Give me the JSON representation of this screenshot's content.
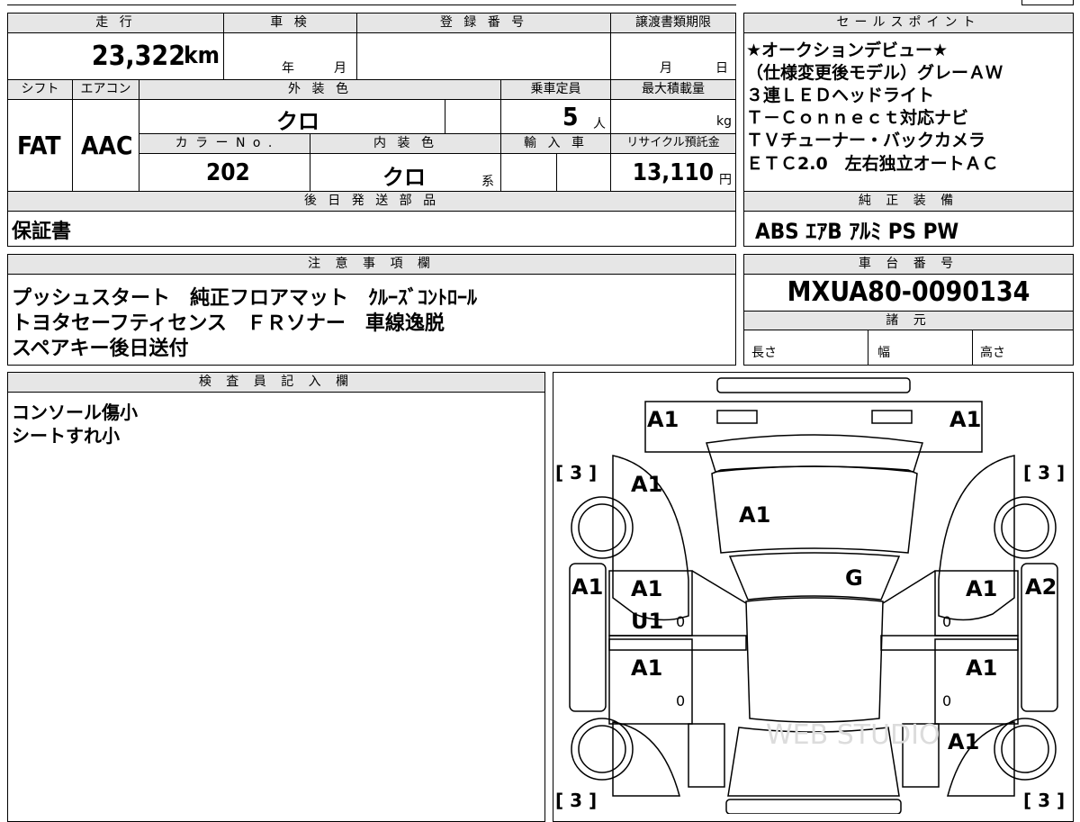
{
  "top_main": {
    "mileage_label": "走 行",
    "inspection_label": "車 検",
    "registration_label": "登 録 番 号",
    "transfer_label": "譲渡書類期限",
    "mileage_value": "23,322",
    "mileage_unit": "km",
    "year_label": "年",
    "month_label": "月",
    "transfer_month": "月",
    "transfer_day": "日",
    "shift_label": "シフト",
    "ac_label": "エアコン",
    "exterior_label": "外 装 色",
    "capacity_label": "乗車定員",
    "maxload_label": "最大積載量",
    "shift_value": "FAT",
    "ac_value": "AAC",
    "exterior_value": "クロ",
    "capacity_value": "5",
    "capacity_unit": "人",
    "maxload_unit": "kg",
    "color_no_label": "カ ラ ー N o .",
    "interior_label": "内 装 色",
    "import_label": "輸 入 車",
    "recycle_label": "リサイクル預託金",
    "color_no_value": "202",
    "interior_value": "クロ",
    "interior_suffix": "系",
    "recycle_value": "13,110",
    "recycle_unit": "円",
    "later_label": "後 日 発 送 部 品",
    "later_value": "保証書"
  },
  "sales_points": {
    "header": "セールスポイント",
    "lines": [
      "★オークションデビュー★",
      "（仕様変更後モデル）グレーＡＷ",
      "３連ＬＥＤヘッドライト",
      "Ｔ－Ｃｏｎｎｅｃｔ対応ナビ",
      "ＴＶチューナー・バックカメラ",
      "ＥＴＣ2.0　左右独立オートＡＣ"
    ]
  },
  "equipment": {
    "header": "純 正 装 備",
    "value": "ABS ｴｱB ｱﾙﾐ PS PW"
  },
  "notes": {
    "header": "注 意 事 項 欄",
    "lines": [
      "プッシュスタート　純正フロアマット　ｸﾙｰｽﾞｺﾝﾄﾛｰﾙ",
      "トヨタセーフティセンス　ＦＲソナー　車線逸脱",
      "スペアキー後日送付"
    ]
  },
  "chassis": {
    "header": "車 台 番 号",
    "value": "MXUA80-0090134",
    "specs_header": "諸 元",
    "length_label": "長さ",
    "width_label": "幅",
    "height_label": "高さ"
  },
  "inspector": {
    "header": "検 査 員 記 入 欄",
    "lines": [
      "コンソール傷小",
      "シートすれ小"
    ]
  },
  "diagram": {
    "marks": {
      "front_left": "A1",
      "front_right": "A1",
      "left_bracket_top": "[ 3 ]",
      "right_bracket_top": "[ 3 ]",
      "fender_left": "A1",
      "hood": "A1",
      "side_left": "A1",
      "roof": "G",
      "front_door_left": "A1",
      "front_door_left_2": "U1",
      "front_door_right": "A1",
      "side_right": "A2",
      "rear_door_left": "A1",
      "rear_door_right": "A1",
      "rear_fender_right": "A1",
      "left_bracket_bottom": "[ 3 ]",
      "right_bracket_bottom": "[ 3 ]",
      "zero": "0",
      "watermark": "WEB STUDIO"
    }
  }
}
